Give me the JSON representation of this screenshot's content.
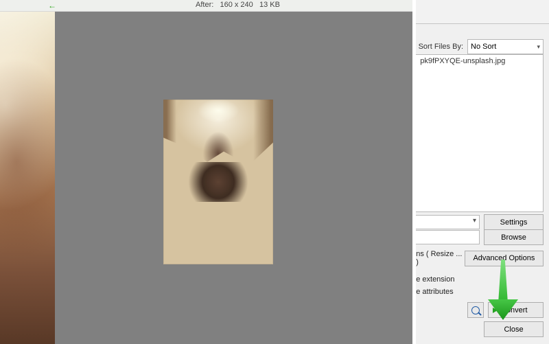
{
  "header": {
    "after_label": "After:",
    "dimensions": "160 x 240",
    "size": "13 KB"
  },
  "sort": {
    "label": "Sort Files By:",
    "selected": "No Sort"
  },
  "file_list": {
    "visible_name": "pk9fPXYQE-unsplash.jpg"
  },
  "buttons": {
    "settings": "Settings",
    "browse": "Browse",
    "advanced_options": "Advanced Options",
    "convert": "Convert",
    "close": "Close"
  },
  "options_title": "ns ( Resize ... )",
  "checkbox_labels": {
    "extension": "e extension",
    "attributes": "e attributes"
  },
  "icons": {
    "back": "back-arrow-icon",
    "preview": "magnifier-icon",
    "play": "play-icon",
    "overlay_arrow": "green-down-arrow"
  }
}
